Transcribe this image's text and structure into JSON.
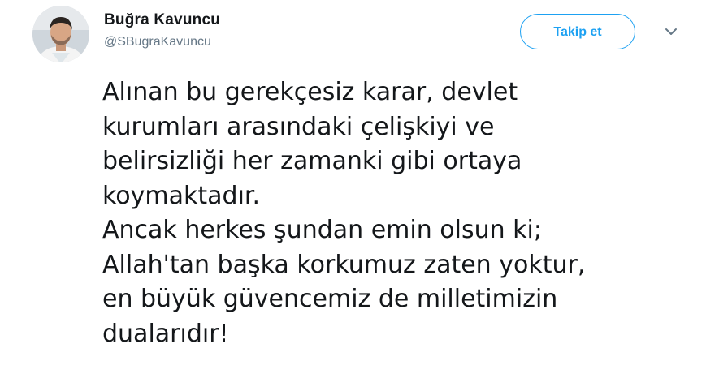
{
  "author": {
    "display_name": "Buğra Kavuncu",
    "handle": "@SBugraKavuncu",
    "avatar_icon": "profile-photo"
  },
  "actions": {
    "follow_label": "Takip et",
    "menu_icon": "chevron-down-icon"
  },
  "colors": {
    "accent": "#1da1f2",
    "text": "#14171a",
    "muted": "#657786"
  },
  "tweet": {
    "lines": [
      "Alınan bu gerekçesiz karar, devlet",
      "kurumları arasındaki çelişkiyi ve",
      "belirsizliği her zamanki gibi ortaya",
      "koymaktadır.",
      "Ancak herkes şundan emin olsun ki;",
      "Allah'tan başka korkumuz zaten yoktur,",
      "en büyük güvencemiz de milletimizin",
      "dualarıdır!"
    ]
  }
}
